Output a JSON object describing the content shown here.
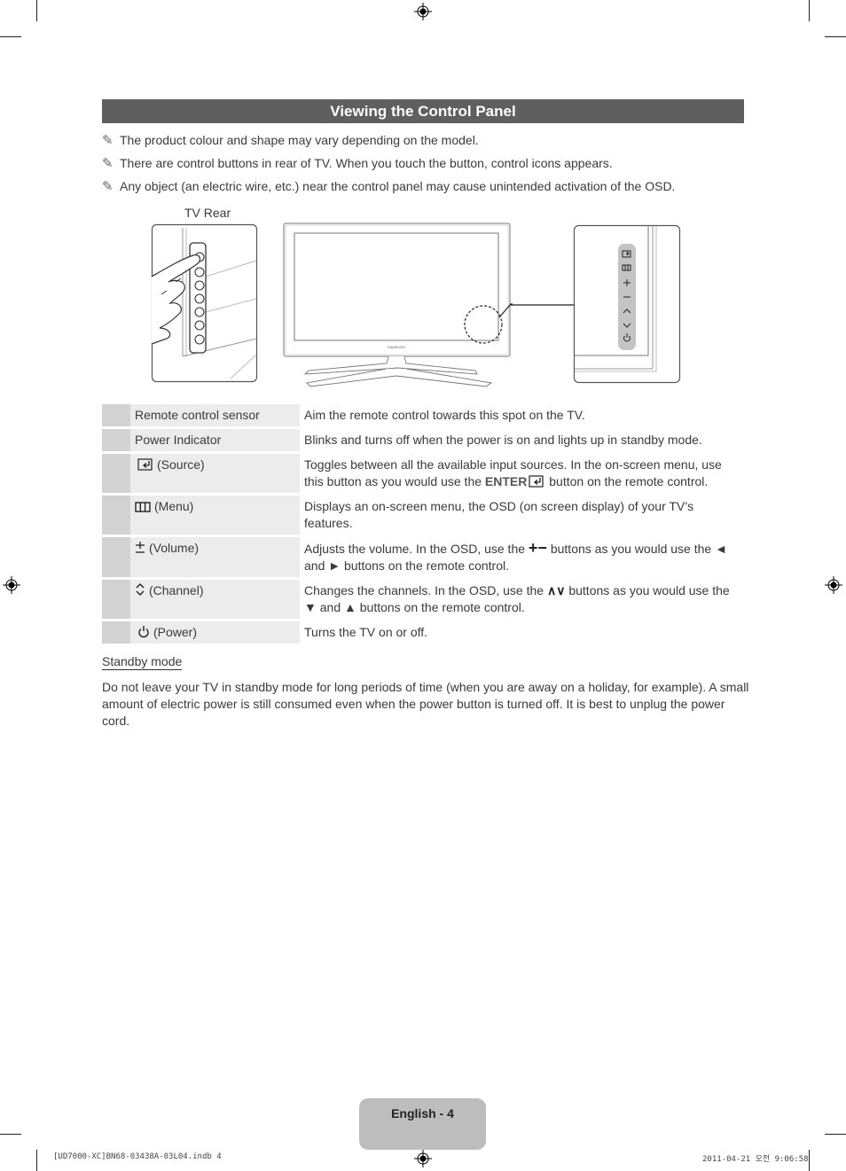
{
  "header": {
    "title": "Viewing the Control Panel"
  },
  "notes": [
    "The product colour and shape may vary depending on the model.",
    "There are control buttons in rear of TV. When you touch the button, control icons appears.",
    "Any object (an electric wire, etc.) near the control panel may cause unintended activation of the OSD."
  ],
  "note_icon": "✎",
  "illustration": {
    "tv_rear_label": "TV Rear",
    "brand_text": "SAMSUNG",
    "panel_icons": [
      "source-icon",
      "menu-icon",
      "plus-icon",
      "minus-icon",
      "chevron-up-icon",
      "chevron-down-icon",
      "power-icon"
    ]
  },
  "table": {
    "rows": [
      {
        "icon": "",
        "name": "Remote control sensor",
        "desc": "Aim the remote control towards this spot on the TV."
      },
      {
        "icon": "",
        "name": "Power Indicator",
        "desc": "Blinks and turns off when the power is on and lights up in standby mode."
      },
      {
        "icon": "source-icon",
        "name": "(Source)",
        "desc_a": "Toggles between all the available input sources. In the on-screen menu, use this button as you would use the ",
        "desc_bold": "ENTER",
        "desc_b": " button on the remote control."
      },
      {
        "icon": "menu-icon",
        "name": "(Menu)",
        "desc": "Displays an on-screen menu, the OSD (on screen display) of your TV’s features."
      },
      {
        "icon": "volume-icon",
        "name": "(Volume)",
        "desc_a": "Adjusts the volume. In the OSD, use the ",
        "desc_sym": "+−",
        "desc_b": " buttons as you would use the ◄ and ► buttons on the remote control."
      },
      {
        "icon": "channel-icon",
        "name": "(Channel)",
        "desc_a": "Changes the channels. In the OSD, use the ",
        "desc_sym": "∧∨",
        "desc_b": " buttons as you would use the ▼ and ▲ buttons on the remote control."
      },
      {
        "icon": "power-icon",
        "name": "(Power)",
        "desc": "Turns the TV on or off."
      }
    ]
  },
  "standby": {
    "heading": "Standby mode",
    "text": "Do not leave your TV in standby mode for long periods of time (when you are away on a holiday, for example). A small amount of electric power is still consumed even when the power button is turned off. It is best to unplug the power cord."
  },
  "footer": {
    "page_label": "English - 4",
    "file_info": "[UD7000-XC]BN68-03438A-03L04.indb   4",
    "timestamp": "2011-04-21   오전 9:06:58"
  }
}
